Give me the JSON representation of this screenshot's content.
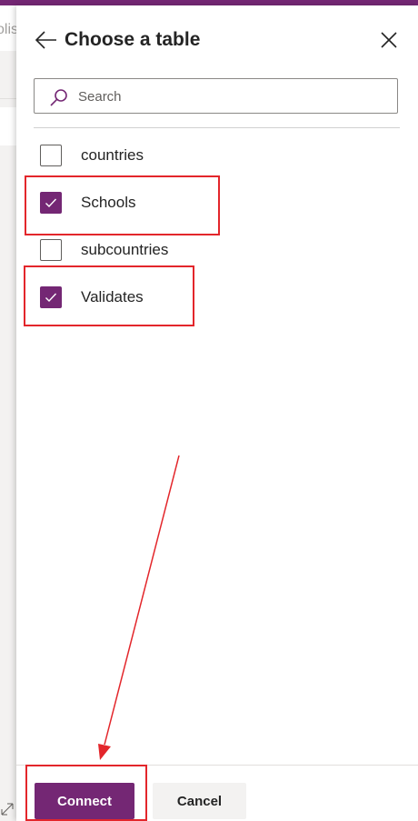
{
  "background_app": {
    "partial_text": "olis"
  },
  "panel": {
    "title": "Choose a table",
    "search": {
      "placeholder": "Search",
      "value": ""
    },
    "tables": [
      {
        "label": "countries",
        "checked": false
      },
      {
        "label": "Schools",
        "checked": true
      },
      {
        "label": "subcountries",
        "checked": false
      },
      {
        "label": "Validates",
        "checked": true
      }
    ],
    "buttons": {
      "connect": "Connect",
      "cancel": "Cancel"
    }
  },
  "colors": {
    "accent": "#742774",
    "annotation": "#e3262b"
  }
}
